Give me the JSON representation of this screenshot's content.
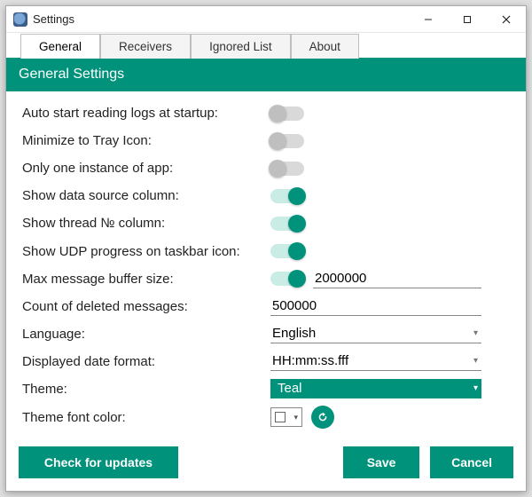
{
  "window": {
    "title": "Settings"
  },
  "tabs": [
    "General",
    "Receivers",
    "Ignored List",
    "About"
  ],
  "active_tab": 0,
  "section_title": "General Settings",
  "settings": {
    "auto_start": {
      "label": "Auto start reading logs at startup:",
      "on": false
    },
    "minimize_tray": {
      "label": "Minimize to Tray Icon:",
      "on": false
    },
    "one_instance": {
      "label": "Only one instance of app:",
      "on": false
    },
    "show_data_source": {
      "label": "Show data source column:",
      "on": true
    },
    "show_thread_no": {
      "label": "Show thread № column:",
      "on": true
    },
    "show_udp_progress": {
      "label": "Show UDP progress on taskbar icon:",
      "on": true
    },
    "max_buffer": {
      "label": "Max message buffer size:",
      "on": true,
      "value": "2000000"
    },
    "deleted_count": {
      "label": "Count of deleted messages:",
      "value": "500000"
    },
    "language": {
      "label": "Language:",
      "value": "English"
    },
    "date_format": {
      "label": "Displayed date format:",
      "value": "HH:mm:ss.fff"
    },
    "theme": {
      "label": "Theme:",
      "value": "Teal"
    },
    "theme_font_color": {
      "label": "Theme font color:"
    }
  },
  "footer": {
    "check_updates": "Check for updates",
    "save": "Save",
    "cancel": "Cancel"
  },
  "colors": {
    "accent": "#00927a"
  }
}
